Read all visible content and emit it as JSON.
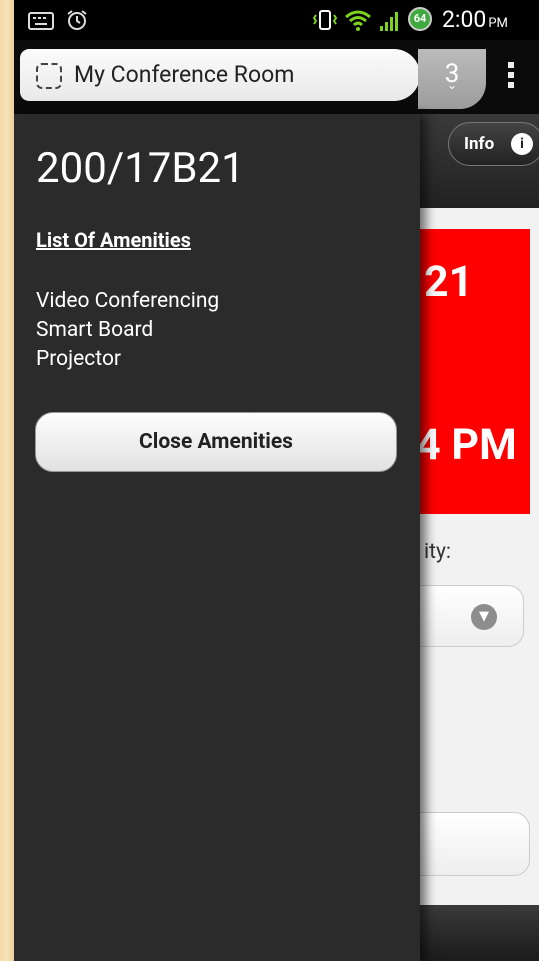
{
  "status_bar": {
    "icons": [
      "keyboard-icon",
      "alarm-icon",
      "vibrate-icon",
      "wifi-icon",
      "signal-icon"
    ],
    "battery_level": "64",
    "time": "2:00",
    "ampm": "PM"
  },
  "browser": {
    "page_title": "My Conference Room",
    "tab_count": "3",
    "tab_chevron": "⌄"
  },
  "page": {
    "info_label": "Info",
    "info_icon_glyph": "i",
    "room_partial": "21",
    "time_partial": "4 PM",
    "capacity_partial": "ity:",
    "accent_red": "#ff0000"
  },
  "panel": {
    "room_number": "200/17B21",
    "amenities_heading": "List Of Amenities",
    "amenities": [
      "Video Conferencing",
      "Smart Board",
      "Projector"
    ],
    "close_label": "Close Amenities"
  }
}
